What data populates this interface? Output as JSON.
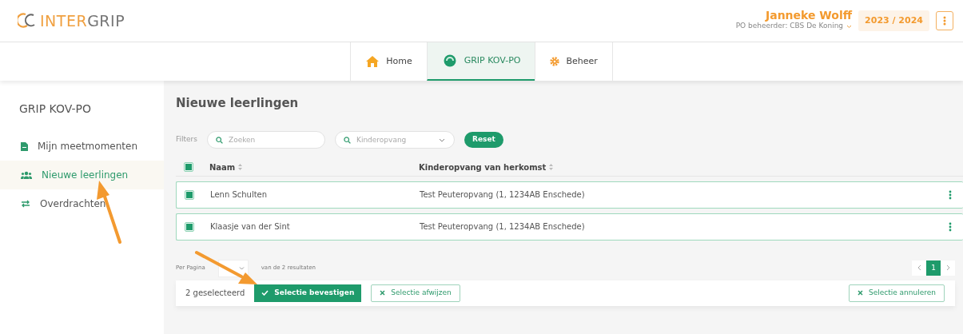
{
  "header": {
    "logo": {
      "prefix": "INTER",
      "suffix": "GRIP"
    },
    "user_name": "Janneke Wolff",
    "role": "PO beheerder: CBS De Koning",
    "school_year": "2023 / 2024"
  },
  "nav_tabs": [
    {
      "label": "Home",
      "selected": false
    },
    {
      "label": "GRIP KOV-PO",
      "selected": true
    },
    {
      "label": "Beheer",
      "selected": false
    }
  ],
  "sidebar": {
    "title": "GRIP KOV-PO",
    "items": [
      {
        "label": "Mijn meetmomenten",
        "selected": false
      },
      {
        "label": "Nieuwe leerlingen",
        "selected": true
      },
      {
        "label": "Overdrachten",
        "selected": false
      }
    ]
  },
  "page_title": "Nieuwe leerlingen",
  "filters": {
    "label": "Filters",
    "search_placeholder": "Zoeken",
    "dropdown_placeholder": "Kinderopvang",
    "reset": "Reset"
  },
  "table": {
    "select_all_checked": true,
    "columns": [
      "Naam",
      "Kinderopvang van herkomst"
    ],
    "rows": [
      {
        "name": "Lenn Schulten",
        "origin": "Test Peuteropvang (1, 1234AB Enschede)",
        "checked": true
      },
      {
        "name": "Klaasje van der Sint",
        "origin": "Test Peuteropvang (1, 1234AB Enschede)",
        "checked": true
      }
    ]
  },
  "pagination": {
    "per_page_label": "Per Pagina",
    "results": "van de 2 resultaten",
    "pages": [
      {
        "label": "1",
        "selected": true
      }
    ]
  },
  "selection_bar": {
    "count": "2 geselecteerd",
    "confirm": "Selectie bevestigen",
    "reject": "Selectie afwijzen",
    "cancel": "Selectie annuleren"
  }
}
